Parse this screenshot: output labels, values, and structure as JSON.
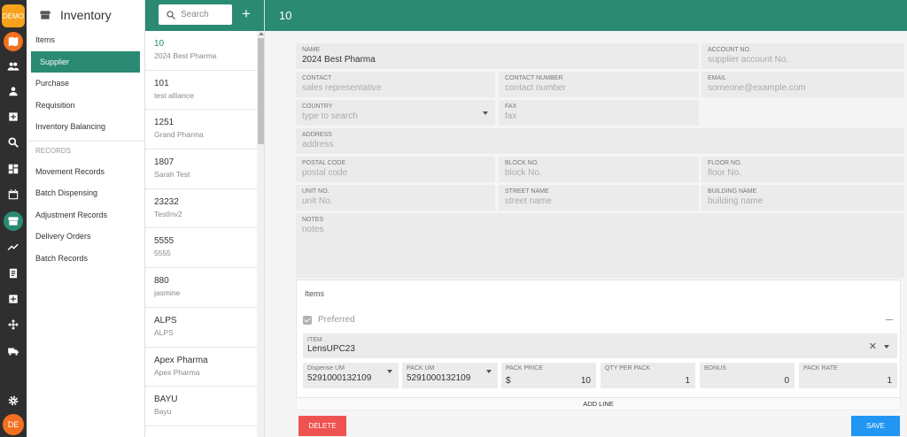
{
  "rail": {
    "badge": "DEMO",
    "user_initials": "DE",
    "icons": [
      "map-icon",
      "group-icon",
      "person-icon",
      "add-box-icon",
      "search-icon",
      "dashboard-icon",
      "calendar-icon",
      "store-icon",
      "trend-icon",
      "receipt-icon",
      "plus-box-icon",
      "move-icon",
      "truck-icon",
      "settings-icon"
    ],
    "accent": "#2a8a72",
    "orange": "#f37021"
  },
  "nav": {
    "title": "Inventory",
    "items": [
      "Items",
      "Supplier",
      "Purchase",
      "Requisition",
      "Inventory Balancing"
    ],
    "section_label": "RECORDS",
    "records": [
      "Movement Records",
      "Batch Dispensing",
      "Adjustment Records",
      "Delivery Orders",
      "Batch Records"
    ]
  },
  "list": {
    "search_placeholder": "Search",
    "add_label": "+",
    "rows": [
      {
        "code": "10",
        "name": "2024 Best Pharma"
      },
      {
        "code": "101",
        "name": "test alliance"
      },
      {
        "code": "1251",
        "name": "Grand Pharma"
      },
      {
        "code": "1807",
        "name": "Sarah Test"
      },
      {
        "code": "23232",
        "name": "TestInv2"
      },
      {
        "code": "5555",
        "name": "5555"
      },
      {
        "code": "880",
        "name": "jasmine"
      },
      {
        "code": "ALPS",
        "name": "ALPS"
      },
      {
        "code": "Apex Pharma",
        "name": "Apex Pharma"
      },
      {
        "code": "BAYU",
        "name": "Bayu"
      }
    ]
  },
  "header": {
    "title": "10"
  },
  "form": {
    "name": {
      "label": "NAME",
      "value": "2024 Best Pharma"
    },
    "account_no": {
      "label": "ACCOUNT NO.",
      "placeholder": "supplier account No."
    },
    "contact": {
      "label": "CONTACT",
      "placeholder": "sales representative"
    },
    "contact_number": {
      "label": "CONTACT NUMBER",
      "placeholder": "contact number"
    },
    "email": {
      "label": "EMAIL",
      "placeholder": "someone@example.com"
    },
    "country": {
      "label": "COUNTRY",
      "placeholder": "type to search"
    },
    "fax": {
      "label": "FAX",
      "placeholder": "fax"
    },
    "address": {
      "label": "ADDRESS",
      "placeholder": "address"
    },
    "postal_code": {
      "label": "POSTAL CODE",
      "placeholder": "postal code"
    },
    "block_no": {
      "label": "BLOCK NO.",
      "placeholder": "block No."
    },
    "floor_no": {
      "label": "FLOOR NO.",
      "placeholder": "floor No."
    },
    "unit_no": {
      "label": "UNIT NO.",
      "placeholder": "unit No."
    },
    "street_name": {
      "label": "STREET NAME",
      "placeholder": "street name"
    },
    "building_name": {
      "label": "BUILDING NAME",
      "placeholder": "building name"
    },
    "notes": {
      "label": "NOTES",
      "placeholder": "notes"
    }
  },
  "items": {
    "title": "Items",
    "preferred_label": "Preferred",
    "item_label": "ITEM",
    "item_value": "LensUPC23",
    "clear_symbol": "✕",
    "dispense_um": {
      "label": "Dispense UM",
      "value": "5291000132109"
    },
    "pack_um": {
      "label": "PACK UM",
      "value": "5291000132109"
    },
    "pack_price": {
      "label": "PACK PRICE",
      "currency": "$",
      "value": "10"
    },
    "qty_per_pack": {
      "label": "QTY PER PACK",
      "value": "1"
    },
    "bonus": {
      "label": "BONUS",
      "value": "0"
    },
    "pack_rate": {
      "label": "PACK RATE",
      "value": "1"
    },
    "add_line_label": "ADD LINE"
  },
  "actions": {
    "delete_label": "DELETE",
    "save_label": "SAVE"
  }
}
